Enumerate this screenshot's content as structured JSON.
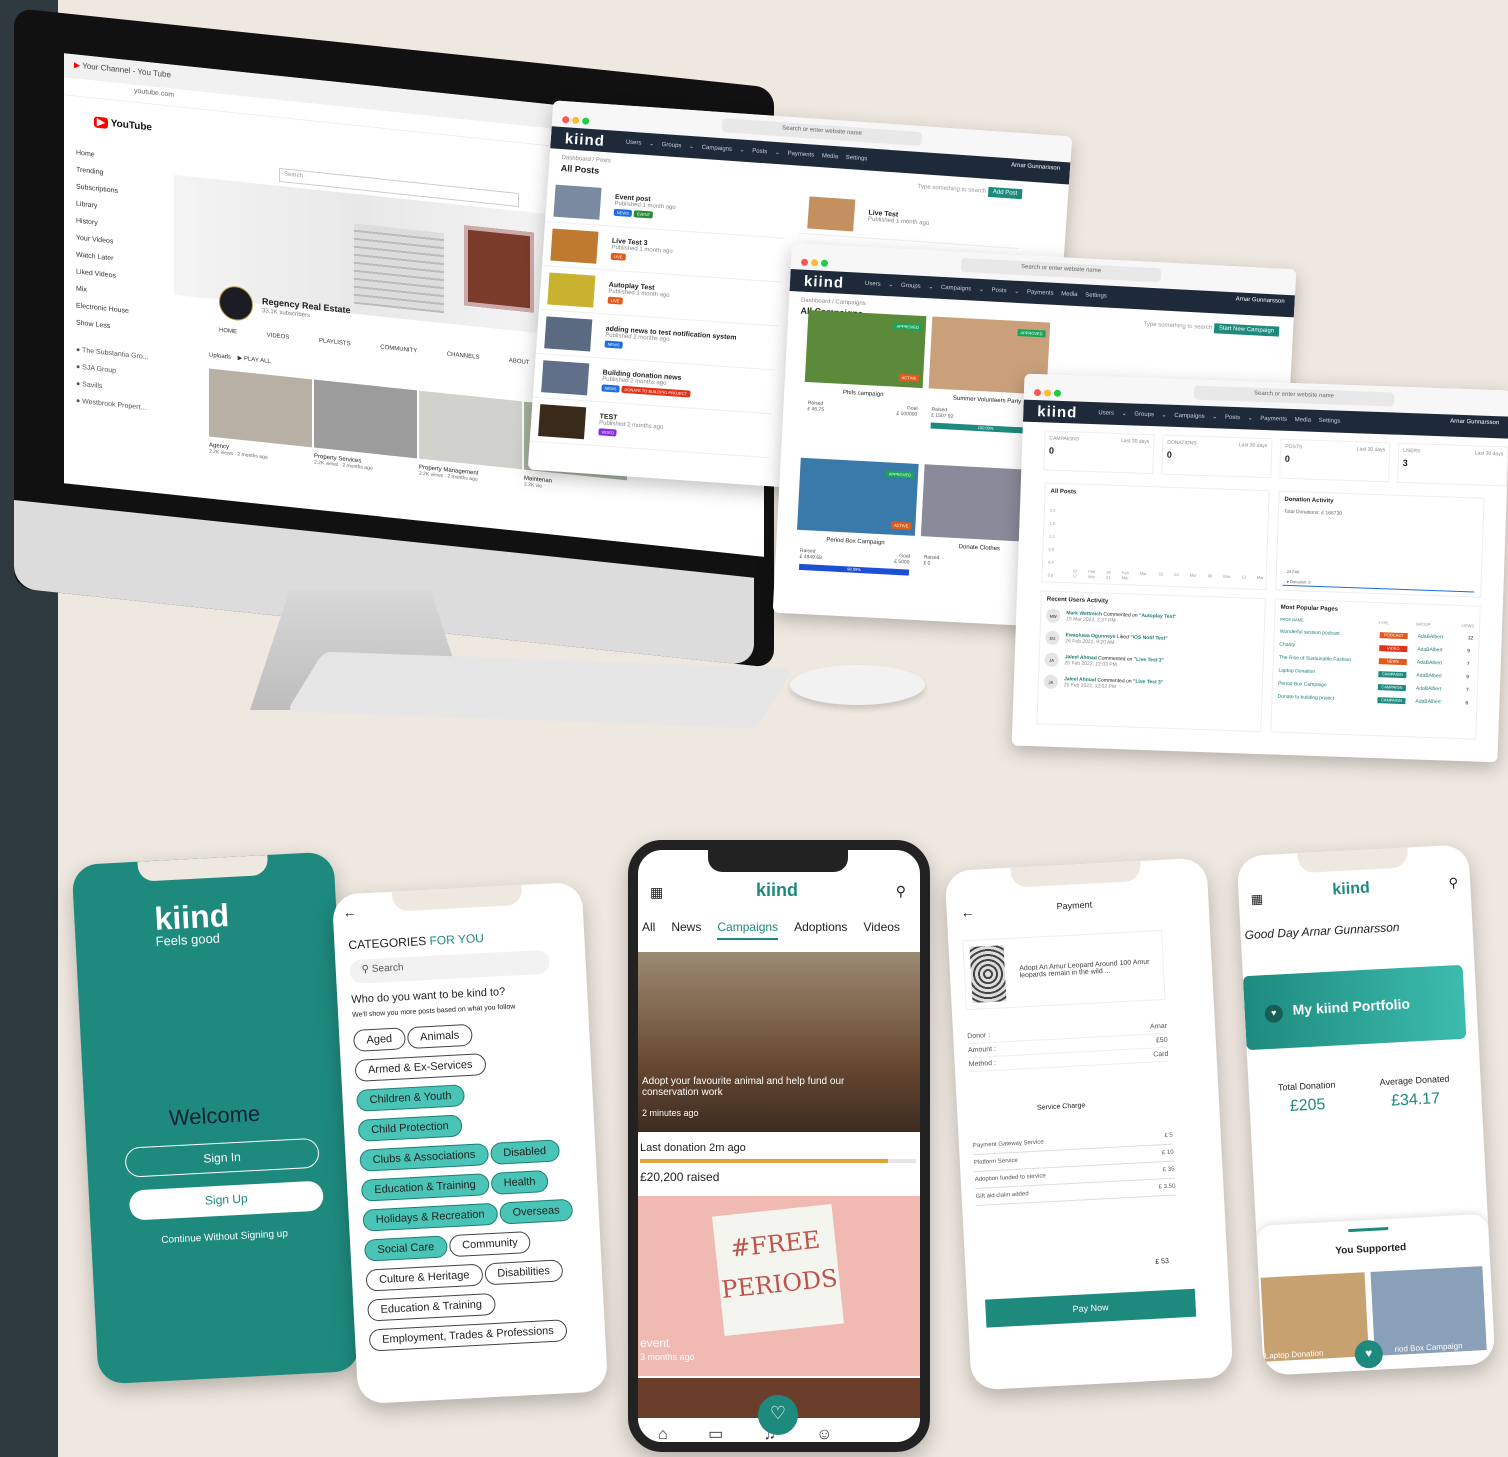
{
  "youtube": {
    "tab_title": "Your Channel - You Tube",
    "url": "youtube.com",
    "logo": "YouTube",
    "search_placeholder": "Search",
    "sidebar": [
      "Home",
      "Trending",
      "Subscriptions",
      "Library",
      "History",
      "Your Videos",
      "Watch Later",
      "Liked Videos",
      "Mix",
      "Electronic House",
      "Show Less"
    ],
    "subscriptions": [
      "The Substantia Gro...",
      "SJA Group",
      "Savills",
      "Westbrook Propert..."
    ],
    "channel_name": "Regency Real Estate",
    "subscribers": "33.1K subscribers",
    "tabs": "HOME VIDEOS PLAYLISTS COMMUNITY CHANNELS ABOUT",
    "uploads": "Uploads",
    "play_all": "PLAY ALL",
    "videos": [
      {
        "title": "Agency",
        "meta": "2.2K views . 2 months ago"
      },
      {
        "title": "Property Services",
        "meta": "2.2K views . 2 months ago"
      },
      {
        "title": "Property Management",
        "meta": "2.2K views . 2 months ago"
      },
      {
        "title": "Maintenan",
        "meta": "2.2K vie"
      }
    ]
  },
  "admin": {
    "url_placeholder": "Search or enter website name",
    "logo": "kiind",
    "menu": "Users ⌄  Groups ⌄  Campaigns ⌄  Posts ⌄  Payments  Media  Settings",
    "user": "Arnar Gunnarsson",
    "posts": {
      "breadcrumb": "Dashboard / Posts",
      "title": "All Posts",
      "search_placeholder": "Type something to search",
      "add_button": "Add Post",
      "items": [
        {
          "title": "Event post",
          "meta": "Published 1 month ago",
          "tags": [
            "NEWS",
            "EVENT"
          ]
        },
        {
          "title": "Live Test 3",
          "meta": "Published 1 month ago",
          "tags": [
            "LIVE"
          ]
        },
        {
          "title": "Autoplay Test",
          "meta": "Published 1 month ago",
          "tags": [
            "LIVE"
          ]
        },
        {
          "title": "adding news to test notification system",
          "meta": "Published 2 months ago",
          "tags": [
            "NEWS"
          ]
        },
        {
          "title": "Building donation news",
          "meta": "Published 2 months ago",
          "tags": [
            "NEWS",
            "DONATE TO BUILDING PROJECT"
          ]
        },
        {
          "title": "TEST",
          "meta": "Published 2 months ago",
          "tags": [
            "VIDEO"
          ]
        }
      ],
      "side_item": {
        "title": "Live Test",
        "meta": "Published 1 month ago"
      }
    },
    "campaigns": {
      "breadcrumb": "Dashboard / Campaigns",
      "title": "All Campaigns",
      "search_placeholder": "Type something to search",
      "start_button": "Start New Campaign",
      "items": [
        {
          "name": "Phils campaign",
          "raised_label": "Raised",
          "raised": "£ 46.75",
          "goal_label": "Goal",
          "goal": "£ 100000",
          "badge": "APPROVED",
          "status": "ACTIVE"
        },
        {
          "name": "Summer Volunteers Party",
          "raised_label": "Raised",
          "raised": "£ 1507.92",
          "badge": "APPROVED",
          "progress": "100.00%"
        },
        {
          "name": "Period Box Campaign",
          "raised_label": "Raised",
          "raised": "£ 4949.68",
          "goal_label": "Goal",
          "goal": "£ 5000",
          "badge": "APPROVED",
          "status": "ACTIVE",
          "progress": "98.99%"
        },
        {
          "name": "Donate Clothes",
          "raised_label": "Raised",
          "raised": "£ 0"
        }
      ]
    },
    "dashboard": {
      "stats": [
        {
          "label": "CAMPAIGNS",
          "period": "Last 30 days",
          "value": "0"
        },
        {
          "label": "DONATIONS",
          "period": "Last 30 days",
          "value": "0"
        },
        {
          "label": "POSTS",
          "period": "Last 30 days",
          "value": "0"
        },
        {
          "label": "USERS",
          "period": "Last 30 days",
          "value": "3"
        }
      ],
      "all_posts": "All Posts",
      "y_ticks": [
        "2.0",
        "1.6",
        "1.2",
        "0.8",
        "0.4",
        "0.0"
      ],
      "x_ticks": [
        "23 Feb",
        "26 Feb",
        "Mar '22",
        "03 Mar",
        "09 Mar",
        "13 Mar",
        "17 Mar",
        "21 Mar"
      ],
      "donation_activity": "Donation Activity",
      "total_donations": "Total Donations: £ 166730",
      "donation_legend": "Donation: 0",
      "donation_date": "24 Feb",
      "recent_activity": "Recent Users Activity",
      "activity": [
        {
          "initials": "MW",
          "name": "Mark Wettreich",
          "action": "Commented on",
          "target": "\"Autoplay Test\"",
          "time": "15 Mar 2022, 2:37 PM"
        },
        {
          "initials": "EO",
          "name": "Ewaoluwa Ogunneye",
          "action": "Liked",
          "target": "\"iOS Notif Test\"",
          "time": "26 Feb 2022, 9:20 AM"
        },
        {
          "initials": "JA",
          "name": "Jaleel Ahmad",
          "action": "Commented on",
          "target": "\"Live Test 3\"",
          "time": "25 Feb 2022, 12:03 PM"
        },
        {
          "initials": "JA",
          "name": "Jaleel Ahmad",
          "action": "Commented on",
          "target": "\"Live Test 3\"",
          "time": "25 Feb 2022, 12:02 PM"
        }
      ],
      "popular_pages": "Most Popular Pages",
      "pages_headers": [
        "PAGE NAME",
        "TYPE",
        "GROUP",
        "VIEWS"
      ],
      "pages": [
        {
          "name": "Wonderful session podcast",
          "type": "PODCAST",
          "group": "AdaBAlbert",
          "views": "12"
        },
        {
          "name": "Charity",
          "type": "VIDEO",
          "group": "AdaBAlbert",
          "views": "9"
        },
        {
          "name": "The Rise of Sustainable Fashion",
          "type": "NEWS",
          "group": "AdaBAlbert",
          "views": "7"
        },
        {
          "name": "Laptop Donation",
          "type": "CAMPAIGN",
          "group": "AdaBAlbert",
          "views": "9"
        },
        {
          "name": "Period Box Campaign",
          "type": "CAMPAIGN",
          "group": "AdaBAlbert",
          "views": "7"
        },
        {
          "name": "Donate to building project",
          "type": "CAMPAIGN",
          "group": "AdaBAlbert",
          "views": "6"
        }
      ]
    }
  },
  "phone_welcome": {
    "logo": "kiind",
    "tagline": "Feels good",
    "welcome": "Welcome",
    "sign_in": "Sign In",
    "sign_up": "Sign Up",
    "continue": "Continue Without Signing up"
  },
  "phone_categories": {
    "title": "CATEGORIES",
    "title_accent": "FOR YOU",
    "search_placeholder": "Search",
    "question": "Who do you want to be kind to?",
    "hint": "We'll show you more posts based on what you follow",
    "chips": [
      {
        "label": "Aged",
        "on": false
      },
      {
        "label": "Animals",
        "on": false
      },
      {
        "label": "Armed & Ex-Services",
        "on": false
      },
      {
        "label": "Children & Youth",
        "on": true
      },
      {
        "label": "Child Protection",
        "on": true
      },
      {
        "label": "Clubs & Associations",
        "on": true
      },
      {
        "label": "Disabled",
        "on": true
      },
      {
        "label": "Education & Training",
        "on": true
      },
      {
        "label": "Health",
        "on": true
      },
      {
        "label": "Holidays & Recreation",
        "on": true
      },
      {
        "label": "Overseas",
        "on": true
      },
      {
        "label": "Social Care",
        "on": true
      },
      {
        "label": "Community",
        "on": false
      },
      {
        "label": "Culture & Heritage",
        "on": false
      },
      {
        "label": "Disabilities",
        "on": false
      },
      {
        "label": "Education & Training",
        "on": false
      },
      {
        "label": "Employment, Trades & Professions",
        "on": false
      }
    ]
  },
  "phone_feed": {
    "logo": "kiind",
    "tabs": [
      "All",
      "News",
      "Campaigns",
      "Adoptions",
      "Videos"
    ],
    "post1_caption": "Adopt your favourite animal and help fund our conservation work",
    "post1_time": "2 minutes ago",
    "last_donation": "Last donation 2m ago",
    "raised": "£20,200 raised",
    "progress": 0.9,
    "poster_text": "#FREE PERIODS",
    "post2_title": "event",
    "post2_time": "3 months ago"
  },
  "phone_payment": {
    "title": "Payment",
    "item": "Adopt An Amur Leopard Around 100 Amur leopards remain in the wild ...",
    "rows": [
      {
        "label": "Donor :",
        "value": "Arnar"
      },
      {
        "label": "Amount :",
        "value": "£50"
      },
      {
        "label": "Method :",
        "value": "Card"
      }
    ],
    "service_title": "Service Charge",
    "charges": [
      {
        "label": "Payment Gateway Service",
        "value": "£ 5"
      },
      {
        "label": "Platform Service",
        "value": "£ 10"
      },
      {
        "label": "Adoption funded to service",
        "value": "£ 35"
      },
      {
        "label": "Gift aid claim added",
        "value": "£ 3.50"
      }
    ],
    "total": "£ 53",
    "pay_button": "Pay Now"
  },
  "phone_portfolio": {
    "logo": "kiind",
    "greeting": "Good Day Arnar Gunnarsson",
    "portfolio": "My kiind Portfolio",
    "total_label": "Total Donation",
    "total": "£205",
    "avg_label": "Average Donated",
    "avg": "£34.17",
    "supported": "You Supported",
    "cards": [
      "Laptop Donation",
      "riod Box Campaign"
    ]
  },
  "colors": {
    "teal": "#1e8a7e",
    "teal_light": "#49c4b6",
    "navy": "#1e2a3a",
    "orange": "#f0a020"
  }
}
